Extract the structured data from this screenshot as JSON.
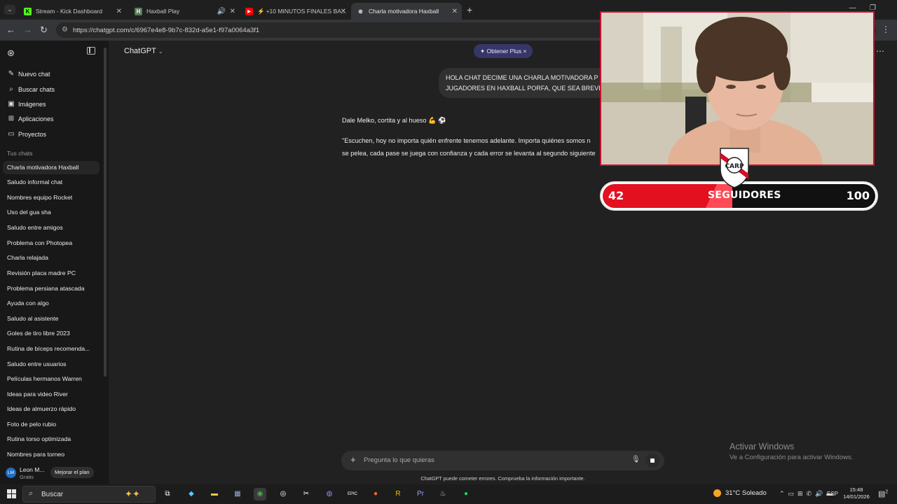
{
  "browser": {
    "tabs": [
      {
        "title": "Stream - Kick Dashboard",
        "favicon": "K",
        "color": "#53fc18"
      },
      {
        "title": "Haxball Play",
        "favicon": "H",
        "color": "#5a7a5a"
      },
      {
        "title": "+10 MINUTOS FINALES BA...",
        "favicon": "▶",
        "color": "#ff0000"
      },
      {
        "title": "Charla motivadora Haxball",
        "favicon": "⊛",
        "color": "#cccccc"
      }
    ],
    "url": "https://chatgpt.com/c/6967e4e8-9b7c-832d-a5e1-f97a0064a3f1"
  },
  "sidebar": {
    "actions": [
      {
        "icon": "edit-icon",
        "label": "Nuevo chat"
      },
      {
        "icon": "search-icon",
        "label": "Buscar chats"
      },
      {
        "icon": "image-icon",
        "label": "Imágenes"
      },
      {
        "icon": "apps-icon",
        "label": "Aplicaciones"
      },
      {
        "icon": "folder-icon",
        "label": "Proyectos"
      }
    ],
    "section_title": "Tus chats",
    "chats": [
      "Charla motivadora Haxball",
      "Saludo informal chat",
      "Nombres equipo Rocket",
      "Uso del gua sha",
      "Saludo entre amigos",
      "Problema con Photopea",
      "Charla relajada",
      "Revisión placa madre PC",
      "Problema persiana atascada",
      "Ayuda con algo",
      "Saludo al asistente",
      "Goles de tiro libre 2023",
      "Rutina de bíceps recomenda...",
      "Saludo entre usuarios",
      "Películas hermanos Warren",
      "Ideas para video River",
      "Ideas de almuerzo rápido",
      "Foto de pelo rubio",
      "Rutina torso optimizada",
      "Nombres para torneo"
    ],
    "user": {
      "initials": "LM",
      "name": "Leon M...",
      "plan": "Gratis",
      "upgrade": "Mejorar el plan"
    }
  },
  "main": {
    "model": "ChatGPT",
    "plus_badge": "✦ Obtener Plus ×",
    "user_message_lines": [
      "HOLA CHAT DECIME UNA CHARLA MOTIVADORA P",
      "JUGADORES EN HAXBALL PORFA, QUE SEA BREVE"
    ],
    "reply_intro": "Dale Melko, cortita y al hueso 💪 ⚽",
    "reply_lines": [
      "\"Escuchen, hoy no importa quién enfrente tenemos adelante. Importa quiénes somos n",
      "se pelea, cada pase se juega con confianza y cada error se levanta al segundo siguiente"
    ],
    "composer_placeholder": "Pregunta lo que quieras",
    "disclaimer": "ChatGPT puede cometer errores. Comprueba la información importante."
  },
  "overlay": {
    "followers_current": "42",
    "followers_label": "SEGUIDORES",
    "followers_goal": "100",
    "progress_fraction": 0.42
  },
  "windows_watermark": {
    "line1": "Activar Windows",
    "line2": "Ve a Configuración para activar Windows."
  },
  "taskbar": {
    "search_label": "Buscar",
    "weather": "31°C  Soleado",
    "language": "ESP",
    "time": "15:48",
    "date": "14/01/2026",
    "notifications": "2"
  }
}
